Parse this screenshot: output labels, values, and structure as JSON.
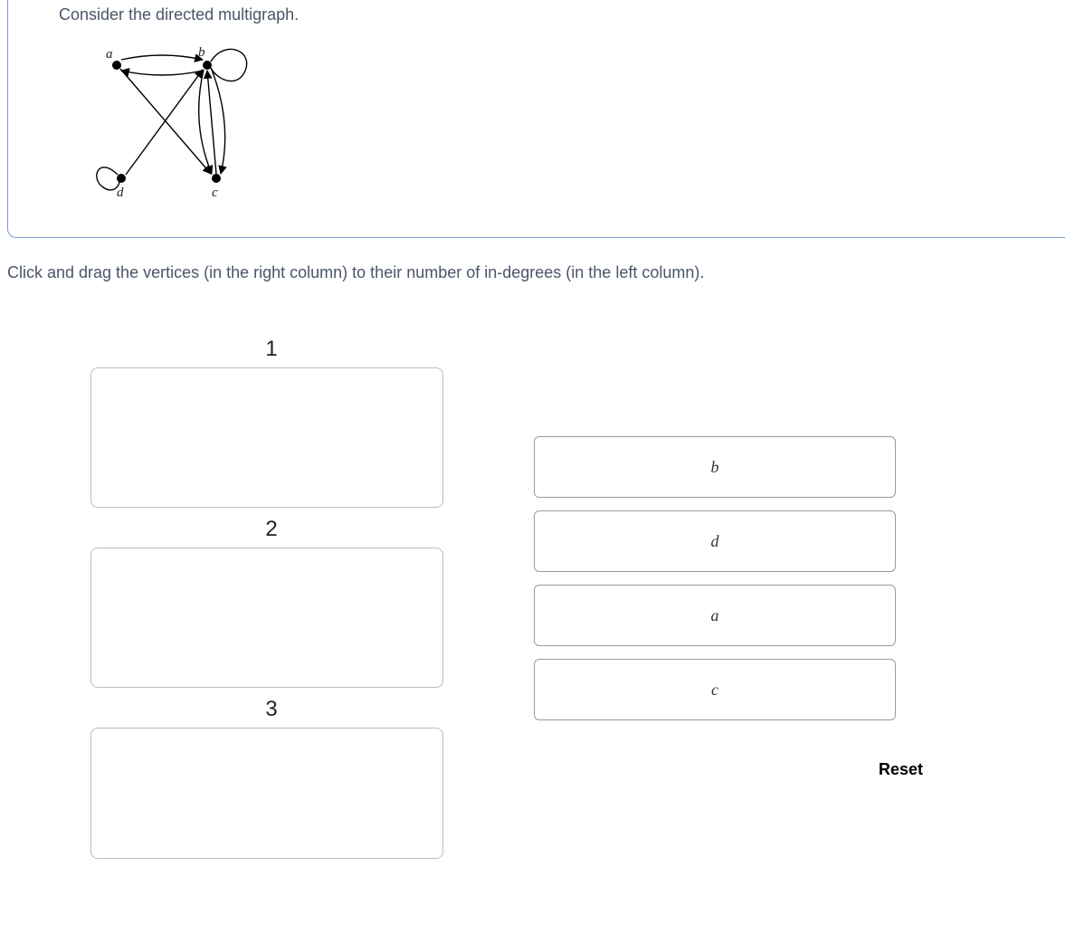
{
  "question": {
    "prompt": "Consider the directed multigraph.",
    "graph_labels": {
      "a": "a",
      "b": "b",
      "c": "c",
      "d": "d"
    }
  },
  "instruction": "Click and drag the vertices (in the right column) to their number of in-degrees (in the left column).",
  "targets": [
    {
      "label": "1"
    },
    {
      "label": "2"
    },
    {
      "label": "3"
    }
  ],
  "items": [
    {
      "label": "b"
    },
    {
      "label": "d"
    },
    {
      "label": "a"
    },
    {
      "label": "c"
    }
  ],
  "reset_label": "Reset"
}
